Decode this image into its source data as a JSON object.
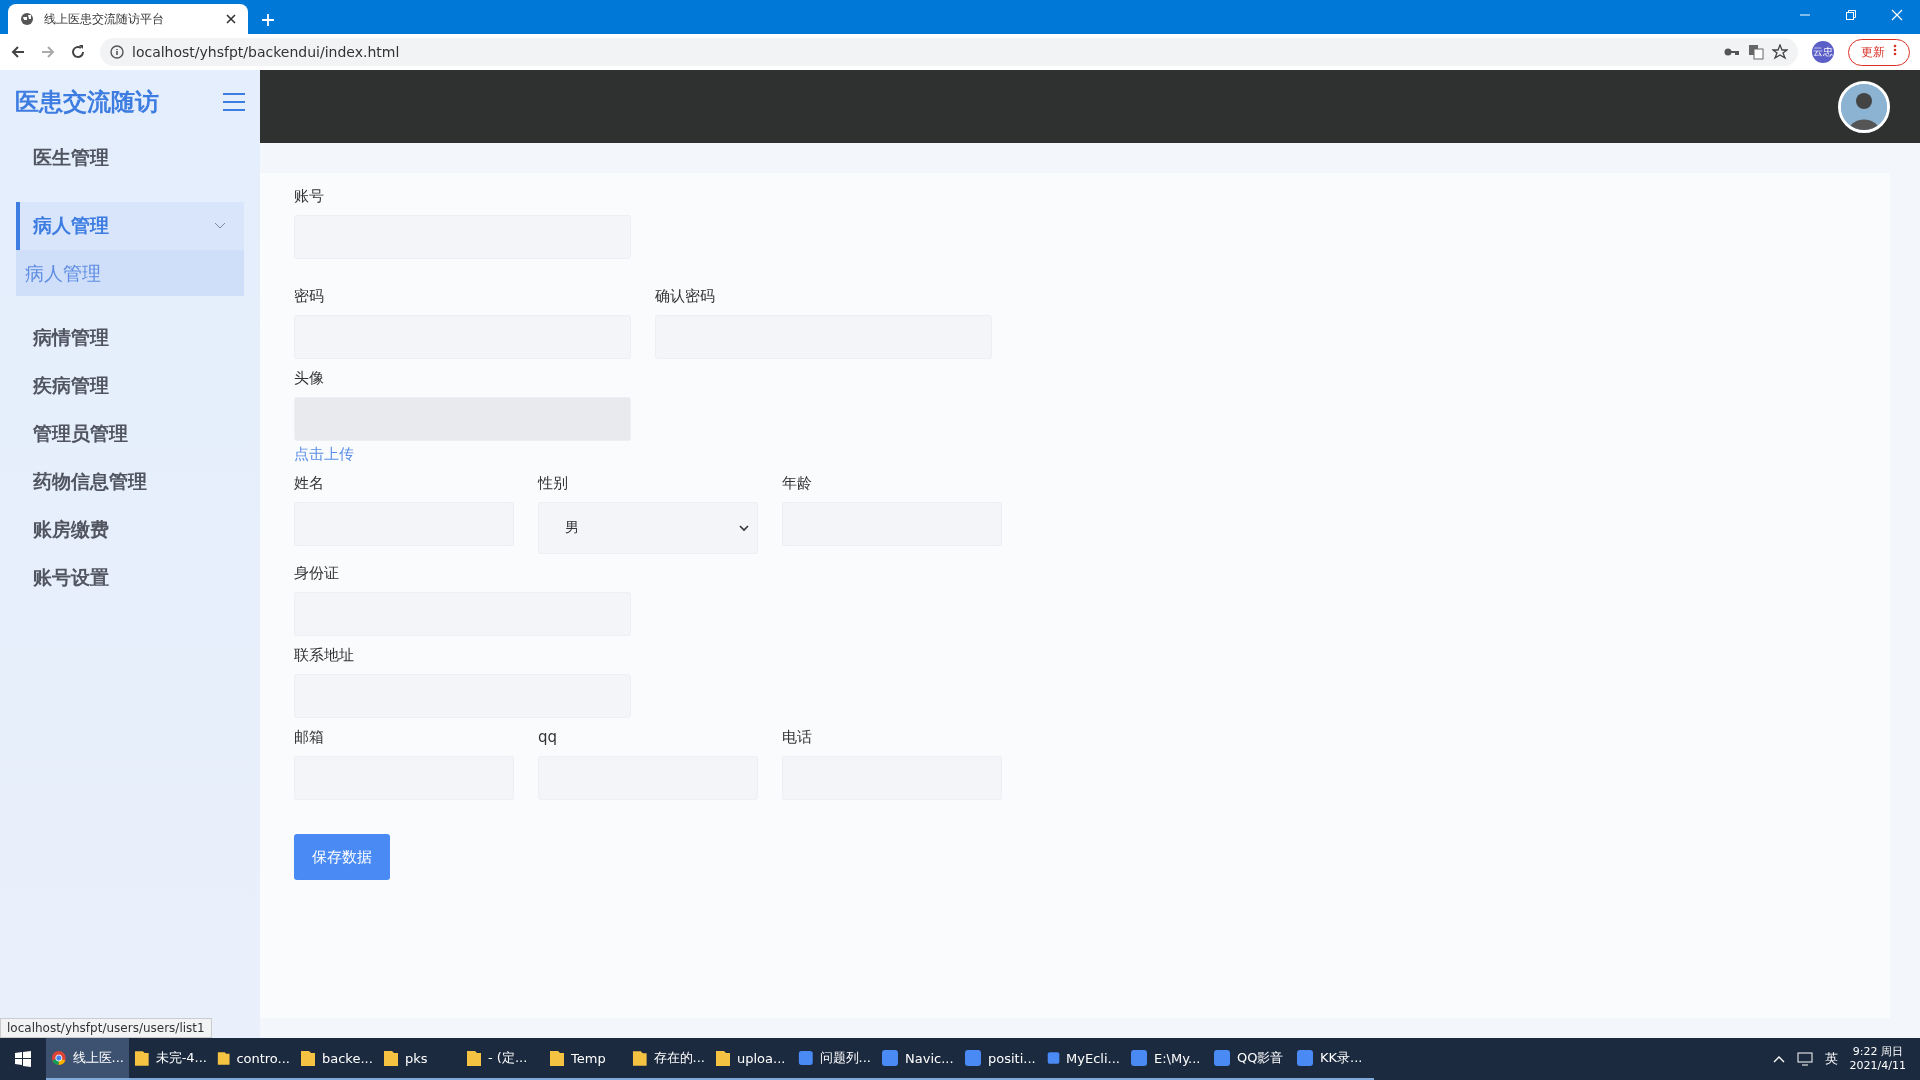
{
  "browser": {
    "tab_title": "线上医患交流随访平台",
    "url": "localhost/yhsfpt/backendui/index.html",
    "profile": "云忠",
    "update_button": "更新"
  },
  "sidebar": {
    "title": "医患交流随访",
    "items": [
      {
        "label": "医生管理",
        "expanded": false
      },
      {
        "label": "病人管理",
        "expanded": true,
        "children": [
          {
            "label": "病人管理",
            "selected": true
          }
        ]
      },
      {
        "label": "病情管理",
        "expanded": false
      },
      {
        "label": "疾病管理",
        "expanded": false
      },
      {
        "label": "管理员管理",
        "expanded": false
      },
      {
        "label": "药物信息管理",
        "expanded": false
      },
      {
        "label": "账房缴费",
        "expanded": false
      },
      {
        "label": "账号设置",
        "expanded": false
      }
    ]
  },
  "form": {
    "rows": [
      [
        {
          "kind": "text",
          "label": "账号"
        }
      ],
      [
        {
          "kind": "text",
          "label": "密码"
        },
        {
          "kind": "text",
          "label": "确认密码"
        }
      ],
      [
        {
          "kind": "upload",
          "label": "头像",
          "link": "点击上传"
        }
      ],
      [
        {
          "kind": "text",
          "label": "姓名"
        },
        {
          "kind": "select",
          "label": "性别",
          "value": "男"
        },
        {
          "kind": "text",
          "label": "年龄"
        }
      ],
      [
        {
          "kind": "text",
          "label": "身份证"
        }
      ],
      [
        {
          "kind": "text",
          "label": "联系地址"
        }
      ],
      [
        {
          "kind": "text",
          "label": "邮箱"
        },
        {
          "kind": "text",
          "label": "qq"
        },
        {
          "kind": "text",
          "label": "电话"
        }
      ]
    ],
    "save_button": "保存数据"
  },
  "status_url": "localhost/yhsfpt/users/users/list1",
  "taskbar": {
    "items": [
      {
        "kind": "browser",
        "label": "线上医...",
        "selected": true
      },
      {
        "kind": "folder",
        "label": "未完-4...",
        "selected": false
      },
      {
        "kind": "folder",
        "label": "contro...",
        "selected": false
      },
      {
        "kind": "folder",
        "label": "backe...",
        "selected": false
      },
      {
        "kind": "folder",
        "label": "pks",
        "selected": false
      },
      {
        "kind": "folder",
        "label": "- (定...",
        "selected": false
      },
      {
        "kind": "folder",
        "label": "Temp",
        "selected": false
      },
      {
        "kind": "folder",
        "label": "存在的...",
        "selected": false
      },
      {
        "kind": "folder",
        "label": "uploa...",
        "selected": false
      },
      {
        "kind": "app",
        "label": "问题列...",
        "selected": false
      },
      {
        "kind": "app",
        "label": "Navic...",
        "selected": false
      },
      {
        "kind": "app",
        "label": "positi...",
        "selected": false
      },
      {
        "kind": "app",
        "label": "MyEcli...",
        "selected": false
      },
      {
        "kind": "app",
        "label": "E:\\My...",
        "selected": false
      },
      {
        "kind": "app",
        "label": "QQ影音",
        "selected": false
      },
      {
        "kind": "app",
        "label": "KK录...",
        "selected": false
      }
    ],
    "ime": "英",
    "time": "9:22 周日",
    "date": "2021/4/11"
  }
}
